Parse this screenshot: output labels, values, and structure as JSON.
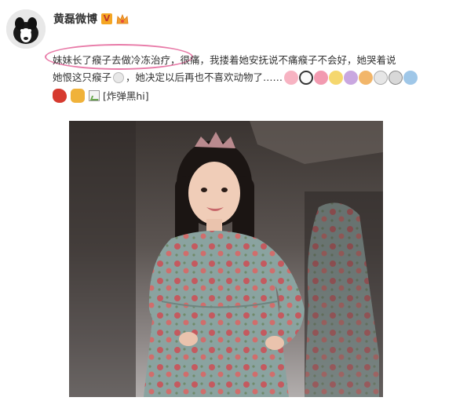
{
  "post": {
    "username": "黄磊微博",
    "verified_badge": "V",
    "text_line1": {
      "highlighted": "妹妹长了瘊子去做冷冻治疗",
      "rest": "，很痛，我搂着她安抚说不痛瘊子不会好，她哭着说"
    },
    "text_line2": "她恨这只瘊子",
    "text_line2_b": "，她决定以后再也不喜欢动物了……",
    "image_alt": "[炸弹黑hi]"
  },
  "colors": {
    "highlight_ring": "#e87ba8",
    "username": "#333333",
    "text": "#333333"
  },
  "icons": {
    "emoji_row1": [
      "pig-face-icon",
      "panda-face-icon",
      "pig-nose-icon",
      "cat-face-icon",
      "bear-face-icon",
      "tiger-face-icon",
      "rabbit-face-icon",
      "monkey-face-icon",
      "alien-face-icon"
    ],
    "emoji_row2": [
      "red-bird-icon",
      "dog-icon"
    ]
  }
}
